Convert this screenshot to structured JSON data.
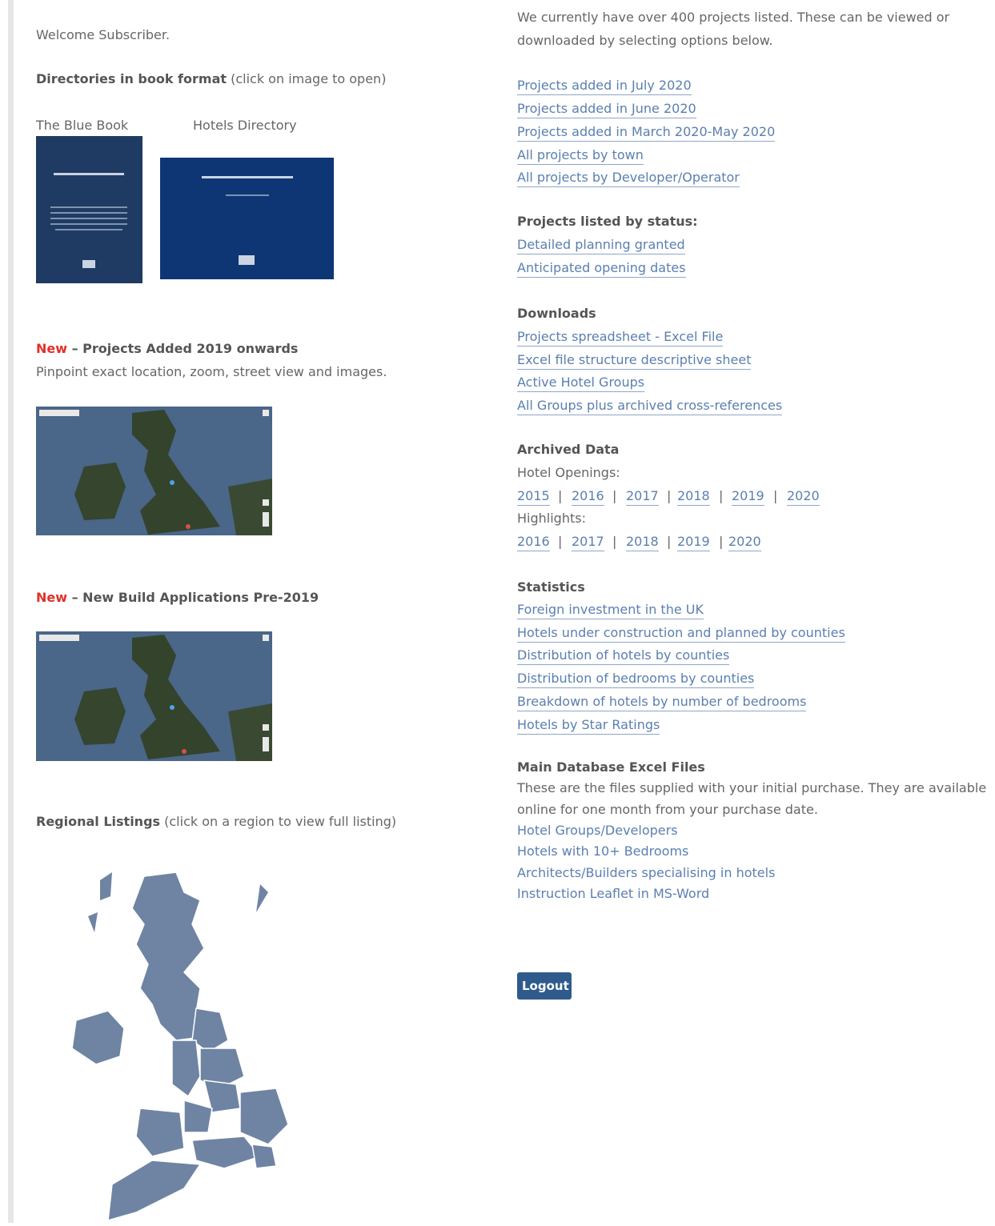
{
  "left": {
    "welcome": "Welcome Subscriber.",
    "directories_title": "Directories in book format",
    "directories_hint": " (click on image to open)",
    "blue_book_label": "The Blue Book",
    "hotels_directory_label": "Hotels Directory",
    "new_label": "New",
    "projects_added_title": " – Projects Added 2019 onwards",
    "projects_added_desc": "Pinpoint exact location, zoom, street view and images.",
    "new_build_title": " – New Build Applications Pre-2019",
    "regional_title": "Regional Listings",
    "regional_hint": " (click on a region to view full listing)"
  },
  "right": {
    "intro_line1": "We currently have over 400 projects listed. These can be viewed or",
    "intro_line2": "downloaded by selecting options below.",
    "project_links": [
      "Projects added in July 2020",
      "Projects added in June 2020",
      "Projects added in March 2020-May 2020",
      "All projects by town",
      "All projects by Developer/Operator"
    ],
    "status_title": "Projects listed by status:",
    "status_links": [
      "Detailed planning granted",
      "Anticipated opening dates"
    ],
    "downloads_title": "Downloads",
    "download_links": [
      "Projects spreadsheet - Excel File",
      "Excel file structure descriptive sheet",
      "Active Hotel Groups",
      "All Groups plus archived cross-references"
    ],
    "archived_title": "Archived Data",
    "openings_label": "Hotel Openings:",
    "openings_years": [
      "2015",
      "2016",
      "2017",
      "2018",
      "2019",
      "2020"
    ],
    "highlights_label": "Highlights:",
    "highlights_years": [
      "2016",
      "2017",
      "2018",
      "2019",
      "2020"
    ],
    "statistics_title": "Statistics",
    "statistics_links": [
      "Foreign investment in the UK",
      "Hotels under construction and planned by counties",
      "Distribution of hotels by counties",
      "Distribution of bedrooms by counties",
      "Breakdown of hotels by number of bedrooms",
      "Hotels by Star Ratings"
    ],
    "main_db_title": "Main Database Excel Files",
    "main_db_line1": "These are the files supplied with your initial purchase. They are available",
    "main_db_line2": "online for one month from your purchase date.",
    "main_db_links": [
      "Hotel Groups/Developers",
      "Hotels with 10+ Bedrooms",
      "Architects/Builders specialising in hotels",
      "Instruction Leaflet in MS-Word"
    ],
    "logout_label": "Logout"
  }
}
